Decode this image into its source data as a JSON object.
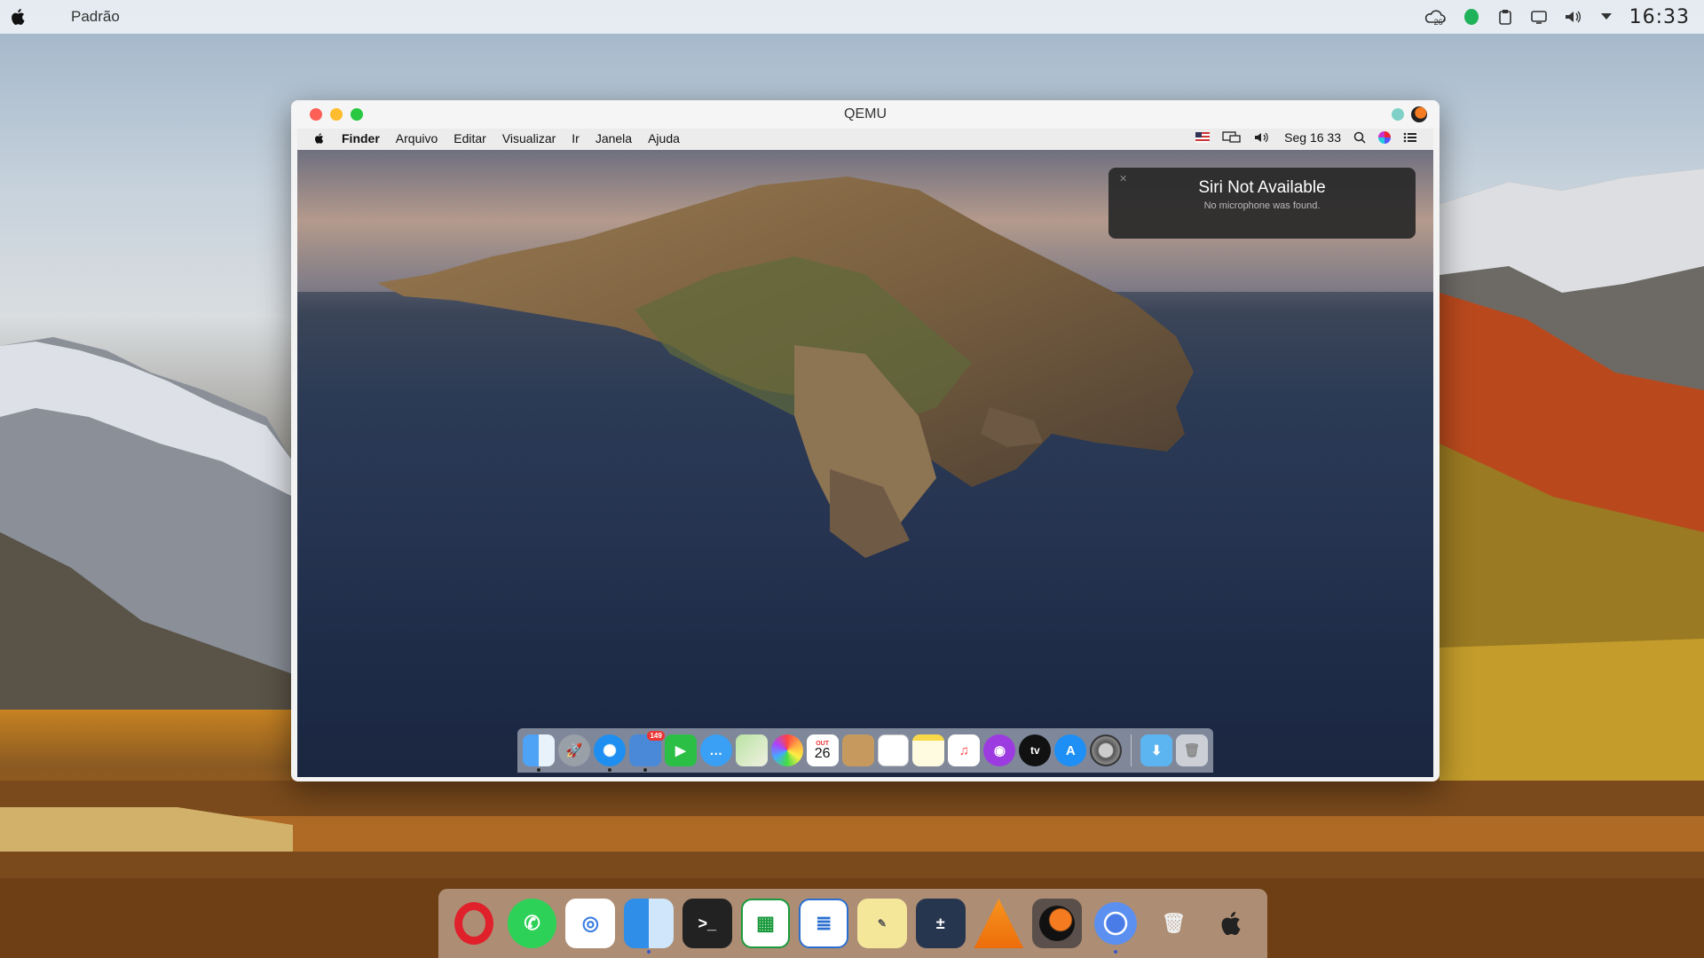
{
  "host_bar": {
    "app_title": "Padrão",
    "weather_temp": "26°",
    "clock": "16:33"
  },
  "qemu_window": {
    "title": "QEMU"
  },
  "guest_menubar": {
    "items": [
      "Finder",
      "Arquivo",
      "Editar",
      "Visualizar",
      "Ir",
      "Janela",
      "Ajuda"
    ],
    "datetime": "Seg 16 33"
  },
  "siri_popup": {
    "title": "Siri Not Available",
    "subtitle": "No microphone was found."
  },
  "guest_dock": {
    "calendar_day": "26",
    "calendar_month": "OUT",
    "mail_badge": "149",
    "tv_label": "tv",
    "apps": [
      "finder",
      "launchpad",
      "safari",
      "mail",
      "facetime",
      "messages",
      "maps",
      "photos",
      "calendar",
      "contacts",
      "reminders",
      "notes",
      "music",
      "podcasts",
      "tv",
      "app-store",
      "system-preferences",
      "downloads",
      "trash"
    ]
  },
  "host_dock": {
    "apps": [
      "opera",
      "whatsapp",
      "tweaks",
      "finder",
      "terminal",
      "spreadsheet",
      "text-editor",
      "notes",
      "calculator",
      "vlc",
      "media-player",
      "chromium",
      "trash",
      "apple"
    ]
  },
  "colors": {
    "close": "#fe5f57",
    "minimize": "#febc2e",
    "maximize": "#28c840"
  }
}
